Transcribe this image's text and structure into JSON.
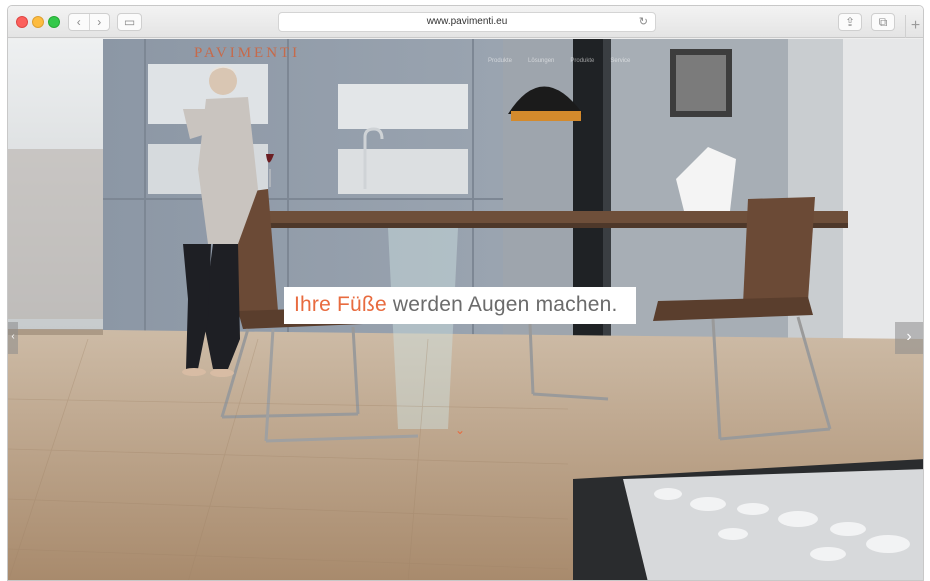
{
  "browser": {
    "url": "www.pavimenti.eu",
    "back_glyph": "‹",
    "forward_glyph": "›",
    "sidebar_glyph": "▭",
    "reload_glyph": "↻",
    "share_glyph": "⇪",
    "tabs_glyph": "⧉",
    "newtab_glyph": "+"
  },
  "site": {
    "logo": "PAVIMENTI",
    "nav": [
      "Produkte",
      "Lösungen",
      "Produkte",
      "Service"
    ],
    "tagline_accent": "Ihre Füße",
    "tagline_rest": " werden Augen machen.",
    "prev_glyph": "‹",
    "next_glyph": "›",
    "scroll_glyph": "⌄"
  },
  "colors": {
    "accent": "#e86b3f",
    "logo": "#c66a4a",
    "floor": "#b49a7f",
    "cabinets": "#8f99a6"
  },
  "icons": {
    "close": "window-close-icon",
    "minimize": "window-minimize-icon",
    "maximize": "window-maximize-icon",
    "back": "chevron-left-icon",
    "forward": "chevron-right-icon",
    "sidebar": "sidebar-icon",
    "reload": "reload-icon",
    "share": "share-icon",
    "tabs": "tabs-icon",
    "new_tab": "plus-icon",
    "slide_prev": "chevron-left-icon",
    "slide_next": "chevron-right-icon",
    "scroll_down": "chevron-down-icon"
  }
}
